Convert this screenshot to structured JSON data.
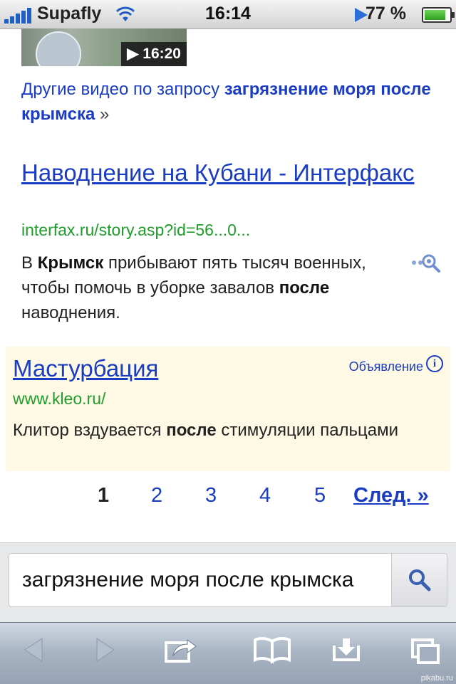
{
  "status_bar": {
    "carrier": "Supafly",
    "time": "16:14",
    "battery_percent": "77 %",
    "battery_level": 0.77
  },
  "video": {
    "duration": "▶ 16:20"
  },
  "more_videos": {
    "prefix": "Другие видео по запросу ",
    "query": "загрязнение моря после крымска",
    "suffix": " »"
  },
  "result": {
    "title": "Наводнение на Кубани - Интерфакс",
    "url": "interfax.ru/story.asp?id=56...0...",
    "snippet_parts": [
      "В ",
      "Крымск",
      " прибывают пять тысяч военных, чтобы помочь в уборке завалов ",
      "после",
      " наводнения."
    ]
  },
  "ad": {
    "title": "Мастурбация",
    "label": "Объявление",
    "info_icon": "i",
    "url": "www.kleo.ru/",
    "snippet_parts": [
      "Клитор вздувается ",
      "после",
      " стимуляции пальцами"
    ]
  },
  "pagination": {
    "pages": [
      "1",
      "2",
      "3",
      "4",
      "5"
    ],
    "current": "1",
    "next_label": "След. »"
  },
  "search": {
    "value": "загрязнение моря после крымска"
  },
  "toolbar": {
    "icons": [
      "back-icon",
      "forward-icon",
      "share-icon",
      "bookmarks-icon",
      "save-icon",
      "tabs-icon"
    ]
  },
  "watermark": "pikabu.ru",
  "colors": {
    "link": "#1a3cc2",
    "url_green": "#1e9e2a",
    "ad_background": "#fdf9e4"
  }
}
